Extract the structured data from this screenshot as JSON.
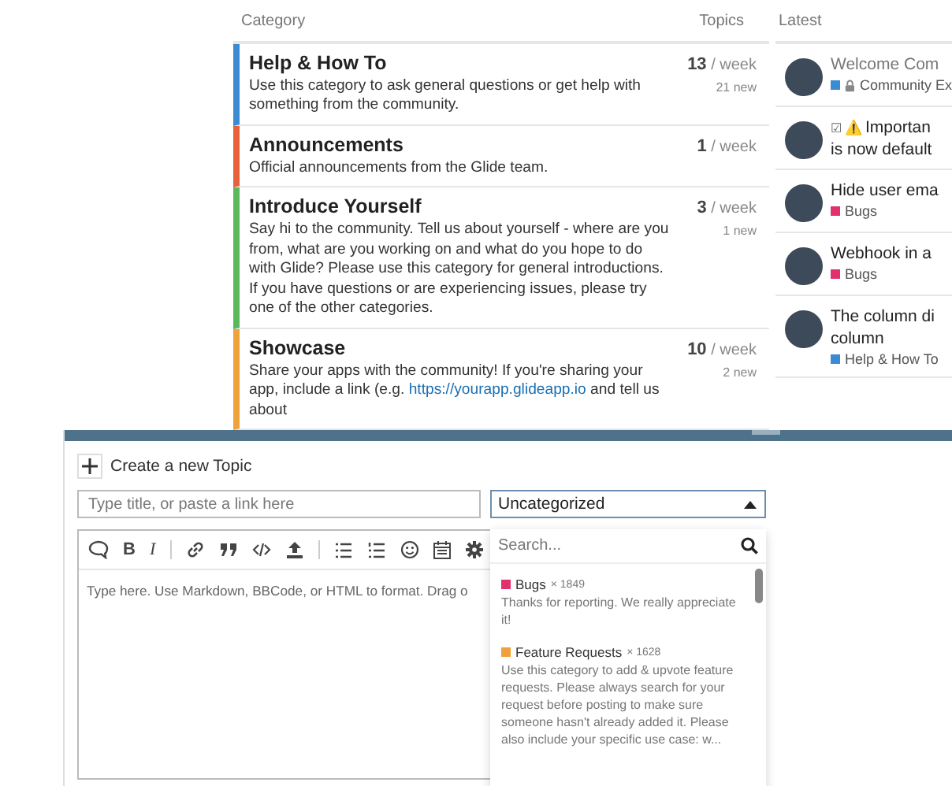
{
  "categories_table": {
    "columns": [
      "Category",
      "Topics"
    ],
    "rows": [
      {
        "name": "Help & How To",
        "color": "#3a8ad4",
        "description": "Use this category to ask general questions or get help with something from the community.",
        "per_week": "13",
        "per_week_unit": "/ week",
        "new": "21 new"
      },
      {
        "name": "Announcements",
        "color": "#e8613a",
        "description": "Official announcements from the Glide team.",
        "per_week": "1",
        "per_week_unit": "/ week"
      },
      {
        "name": "Introduce Yourself",
        "color": "#5cb85c",
        "description": "Say hi to the community. Tell us about yourself - where are you from, what are you working on and what do you hope to do with Glide? Please use this category for general introductions. If you have questions or are experiencing issues, please try one of the other categories.",
        "per_week": "3",
        "per_week_unit": "/ week",
        "new": "1 new"
      },
      {
        "name": "Showcase",
        "color": "#f0a23a",
        "description": "Share your apps with the community! If you're sharing your app, include a link (e.g. ",
        "link": "https://yourapp.glideapp.io",
        "description_after": " and tell us about",
        "per_week": "10",
        "per_week_unit": "/ week",
        "new": "2 new"
      }
    ]
  },
  "latest": {
    "heading": "Latest",
    "items": [
      {
        "title_lines": [
          "Welcome Com"
        ],
        "category": "Community Ex",
        "color": "#3a8ad4",
        "locked": true
      },
      {
        "title_lines": [
          "Importan",
          "is now default"
        ],
        "checkbox": "☑",
        "warning": "⚠️"
      },
      {
        "title_lines": [
          "Hide user ema"
        ],
        "category": "Bugs",
        "color": "#e0316e"
      },
      {
        "title_lines": [
          "Webhook in a"
        ],
        "category": "Bugs",
        "color": "#e0316e"
      },
      {
        "title_lines": [
          "The column di",
          "column"
        ],
        "category": "Help & How To",
        "color": "#3a8ad4"
      }
    ]
  },
  "composer": {
    "action": "Create a new Topic",
    "title_placeholder": "Type title, or paste a link here",
    "category_value": "Uncategorized",
    "toolbar": [
      {
        "kind": "quote"
      },
      {
        "kind": "bold",
        "label": "B"
      },
      {
        "kind": "italic",
        "label": "I"
      },
      {
        "kind": "sep"
      },
      {
        "kind": "link"
      },
      {
        "kind": "blockquote"
      },
      {
        "kind": "code"
      },
      {
        "kind": "upload"
      },
      {
        "kind": "sep"
      },
      {
        "kind": "bullets"
      },
      {
        "kind": "numbers"
      },
      {
        "kind": "emoji"
      },
      {
        "kind": "calendar"
      },
      {
        "kind": "gear"
      }
    ],
    "editor_placeholder": "Type here. Use Markdown, BBCode, or HTML to format. Drag o",
    "dropdown": {
      "search_placeholder": "Search...",
      "options": [
        {
          "name": "Bugs",
          "count": "× 1849",
          "color": "#e0316e",
          "description": "Thanks for reporting. We really appreciate it!"
        },
        {
          "name": "Feature Requests",
          "count": "× 1628",
          "color": "#f0a23a",
          "description": "Use this category to add & upvote feature requests. Please always search for your request before posting to make sure someone hasn't already added it. Please also include your specific use case: w..."
        }
      ]
    }
  }
}
